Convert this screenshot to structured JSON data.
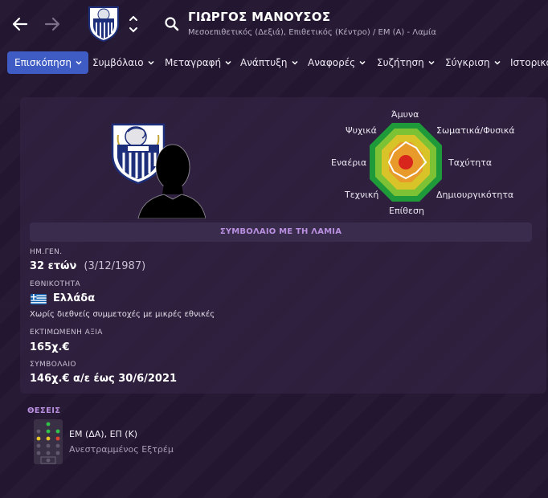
{
  "header": {
    "player_name": "ΓΙΩΡΓΟΣ ΜΑΝΟΥΣΟΣ",
    "subtitle": "Μεσοεπιθετικός (Δεξιά), Επιθετικός (Κέντρο) / ΕΜ (Α) - Λαμία",
    "back_icon": "arrow-left-icon",
    "forward_icon": "arrow-right-icon",
    "search_icon": "search-icon"
  },
  "tabs": [
    {
      "label": "Επισκόπηση",
      "active": true
    },
    {
      "label": "Συμβόλαιο"
    },
    {
      "label": "Μεταγραφή"
    },
    {
      "label": "Ανάπτυξη"
    },
    {
      "label": "Αναφορές"
    },
    {
      "label": "Συζήτηση"
    },
    {
      "label": "Σύγκριση"
    },
    {
      "label": "Ιστορικό"
    }
  ],
  "radar": {
    "labels": {
      "top": "Άμυνα",
      "top_left": "Ψυχικά",
      "top_right": "Σωματικά/Φυσικά",
      "left": "Εναέρια",
      "right": "Ταχύτητα",
      "bottom_left": "Τεχνική",
      "bottom_right": "Δημιουργικότητα",
      "bottom": "Επίθεση"
    },
    "colors": [
      "#1f9a3a",
      "#7cc234",
      "#d8c328",
      "#e89b2a",
      "#d8261c"
    ]
  },
  "contract_banner": "ΣΥΜΒΟΛΑΙΟ ΜΕ ΤΗ ΛΑΜΙΑ",
  "info": {
    "dob_label": "ΗΜ.ΓΕΝ.",
    "age": "32 ετών",
    "dob": "(3/12/1987)",
    "nationality_label": "ΕΘΝΙΚΟΤΗΤΑ",
    "nationality": "Ελλάδα",
    "international_note": "Χωρίς διεθνείς συμμετοχές με μικρές εθνικές",
    "value_label": "ΕΚΤΙΜΩΜΕΝΗ ΑΞΙΑ",
    "value": "165χ.€",
    "contract_label": "ΣΥΜΒΟΛΑΙΟ",
    "contract": "146χ.€ α/ε έως 30/6/2021"
  },
  "positions": {
    "title": "ΘΕΣΕΙΣ",
    "main": "ΕΜ (ΔΑ), ΕΠ (Κ)",
    "role": "Ανεστραμμένος Εξτρέμ"
  }
}
